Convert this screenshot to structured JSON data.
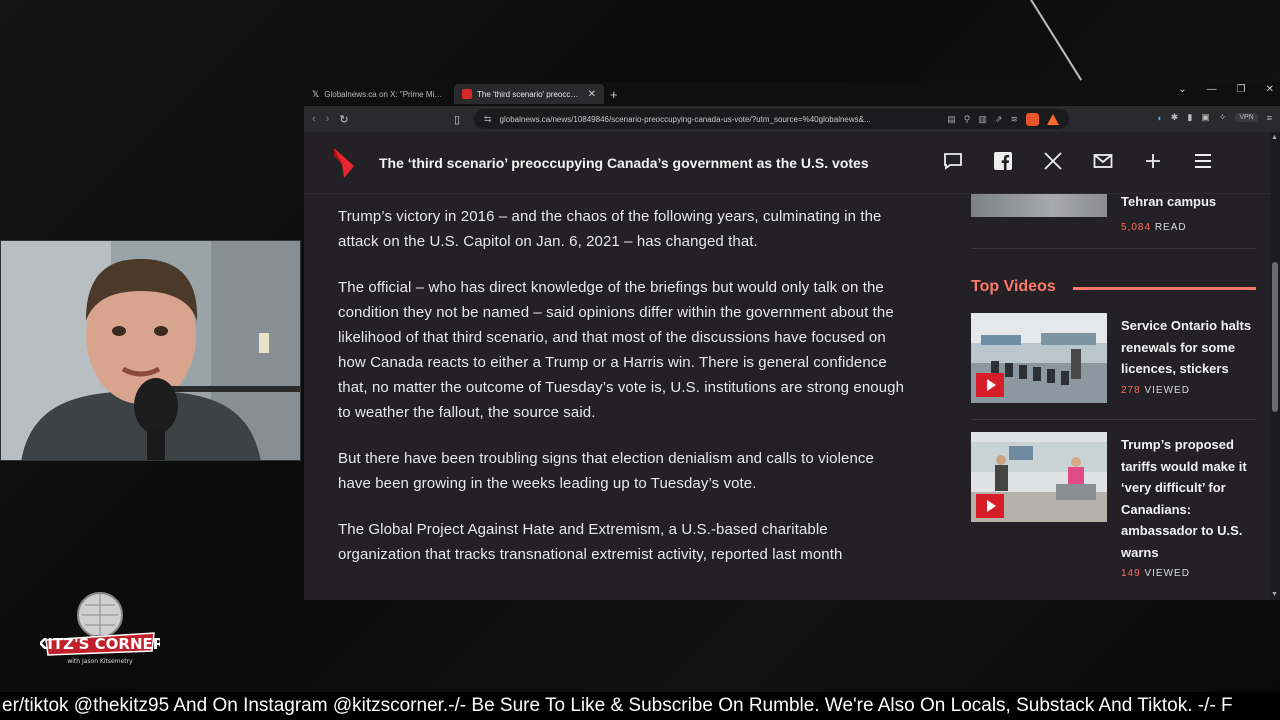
{
  "browser": {
    "tabs": [
      {
        "title": "Globalnews.ca on X: \"Prime Minister",
        "active": false,
        "favicon": "x-icon"
      },
      {
        "title": "The 'third scenario' preoccupyi",
        "active": true,
        "favicon": "global-news-icon"
      }
    ],
    "url": "globalnews.ca/news/10849846/scenario-preoccupying-canada-us-vote/?utm_source=%40globalnews&...",
    "vpn_label": "VPN"
  },
  "site": {
    "header_title": "The ‘third scenario’ preoccupying Canada’s government as the U.S. votes",
    "brand_color": "#e8262d"
  },
  "article": {
    "paragraphs": [
      "Trump’s victory in 2016 – and the chaos of the following years, culminating in the attack on the U.S. Capitol on Jan. 6, 2021 – has changed that.",
      "The official – who has direct knowledge of the briefings but would only talk on the condition they not be named – said opinions differ within the government about the likelihood of that third scenario, and that most of the discussions have focused on how Canada reacts to either a Trump or a Harris win. There is general confidence that, no matter the outcome of Tuesday’s vote is, U.S. institutions are strong enough to weather the fallout, the source said.",
      "But there have been troubling signs that election denialism and calls to violence have been growing in the weeks leading up to Tuesday’s vote.",
      "The Global Project Against Hate and Extremism, a U.S.-based charitable organization that tracks transnational extremist activity, reported last month"
    ]
  },
  "sidebar": {
    "top_story": {
      "title": "Tehran campus",
      "count": "5,084",
      "count_label": "READ"
    },
    "top_videos_heading": "Top Videos",
    "videos": [
      {
        "title": "Service Ontario halts renewals for some licences, stickers",
        "count": "278",
        "count_label": "VIEWED"
      },
      {
        "title": "Trump’s proposed tariffs would make it ‘very difficult’ for Canadians: ambassador to U.S. warns",
        "count": "149",
        "count_label": "VIEWED"
      }
    ]
  },
  "stream": {
    "logo_text": "KITZ'S CORNER",
    "logo_sub": "with Jason Kitsemetry",
    "ticker": "er/tiktok @thekitz95 And On Instagram @kitzscorner.-/- Be Sure To Like & Subscribe On Rumble. We're Also On Locals, Substack And Tiktok. -/- F"
  }
}
